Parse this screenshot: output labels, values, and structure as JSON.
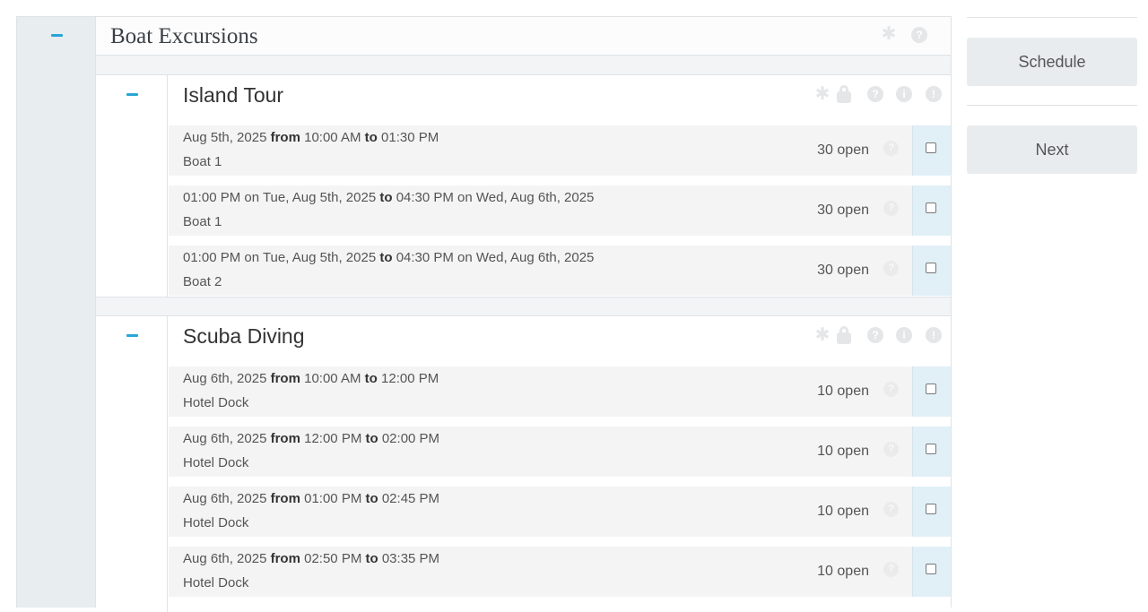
{
  "category": {
    "title": "Boat Excursions",
    "header_icons": [
      "asterisk-icon",
      "help-icon"
    ]
  },
  "groups": [
    {
      "title": "Island Tour",
      "header_icons": [
        "asterisk-icon",
        "lock-icon",
        "help-icon",
        "info-icon",
        "alert-icon"
      ],
      "slots": [
        {
          "date_start": "Aug 5th, 2025",
          "from": "from",
          "time_start": "10:00 AM",
          "to": "to",
          "time_end": "01:30 PM",
          "location": "Boat 1",
          "availability": "30 open"
        },
        {
          "date_start": "01:00 PM on Tue, Aug 5th, 2025",
          "to": "to",
          "time_end": "04:30 PM on Wed, Aug 6th, 2025",
          "location": "Boat 1",
          "availability": "30 open"
        },
        {
          "date_start": "01:00 PM on Tue, Aug 5th, 2025",
          "to": "to",
          "time_end": "04:30 PM on Wed, Aug 6th, 2025",
          "location": "Boat 2",
          "availability": "30 open"
        }
      ]
    },
    {
      "title": "Scuba Diving",
      "header_icons": [
        "asterisk-icon",
        "lock-icon",
        "help-icon",
        "info-icon",
        "alert-icon"
      ],
      "slots": [
        {
          "date_start": "Aug 6th, 2025",
          "from": "from",
          "time_start": "10:00 AM",
          "to": "to",
          "time_end": "12:00 PM",
          "location": "Hotel Dock",
          "availability": "10 open"
        },
        {
          "date_start": "Aug 6th, 2025",
          "from": "from",
          "time_start": "12:00 PM",
          "to": "to",
          "time_end": "02:00 PM",
          "location": "Hotel Dock",
          "availability": "10 open"
        },
        {
          "date_start": "Aug 6th, 2025",
          "from": "from",
          "time_start": "01:00 PM",
          "to": "to",
          "time_end": "02:45 PM",
          "location": "Hotel Dock",
          "availability": "10 open"
        },
        {
          "date_start": "Aug 6th, 2025",
          "from": "from",
          "time_start": "02:50 PM",
          "to": "to",
          "time_end": "03:35 PM",
          "location": "Hotel Dock",
          "availability": "10 open"
        }
      ]
    }
  ],
  "sidebar": {
    "schedule_label": "Schedule",
    "next_label": "Next"
  },
  "colors": {
    "accent": "#27a6d6",
    "gutter": "#e8edef",
    "checkbox_cell": "#e1f0f7",
    "button": "#e8ecef"
  }
}
